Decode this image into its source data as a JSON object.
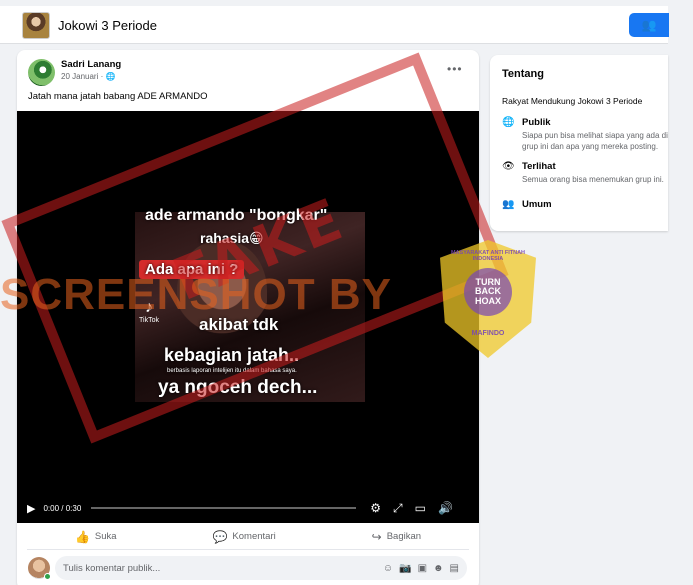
{
  "header": {
    "group_name": "Jokowi 3 Periode"
  },
  "post": {
    "author": "Sadri Lanang",
    "date": "20 Januari ·",
    "text": "Jatah mana jatah babang ADE ARMANDO",
    "video": {
      "lines": [
        "ade armando \"bongkar\"",
        "rahasia😁",
        "Ada apa ini ?",
        "akibat tdk",
        "kebagian jatah..",
        "berbasis laporan intelijen itu dalam bahasa saya.",
        "ya ngoceh dech..."
      ],
      "tiktok_label": "TikTok",
      "time": "0:00 / 0:30",
      "progress": 0
    },
    "actions": {
      "like": "Suka",
      "comment": "Komentari",
      "share": "Bagikan"
    },
    "comment_placeholder": "Tulis komentar publik..."
  },
  "watermark": {
    "stamp": "FAKE",
    "screenshot_by": "SCREENSHOT BY",
    "logo_top": "MASYARAKAT ANTI FITNAH INDONESIA",
    "logo_center": "TURN BACK HOAX",
    "logo_bottom": "MAFINDO"
  },
  "sidebar": {
    "title": "Tentang",
    "description": "Rakyat Mendukung Jokowi 3 Periode",
    "items": [
      {
        "label": "Publik",
        "sub": "Siapa pun bisa melihat siapa yang ada di grup ini dan apa yang mereka posting.",
        "icon": "globe-icon"
      },
      {
        "label": "Terlihat",
        "sub": "Semua orang bisa menemukan grup ini.",
        "icon": "eye-icon"
      },
      {
        "label": "Umum",
        "icon": "people-icon"
      }
    ]
  },
  "colors": {
    "accent": "#1877f2",
    "stamp": "#c81e1e",
    "watermark": "#e8621e"
  }
}
